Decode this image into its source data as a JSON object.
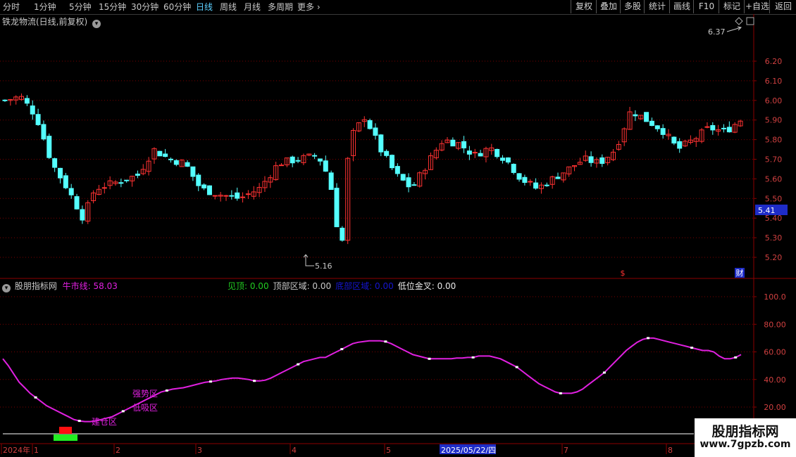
{
  "toolbar": {
    "timeframes": [
      "分时",
      "1分钟",
      "5分钟",
      "15分钟",
      "30分钟",
      "60分钟",
      "日线",
      "周线",
      "月线",
      "多周期",
      "更多"
    ],
    "active_timeframe": "日线",
    "right_buttons": [
      "复权",
      "叠加",
      "多股",
      "统计",
      "画线",
      "F10",
      "标记",
      "+自选",
      "返回"
    ]
  },
  "price_panel": {
    "stock_title": "铁龙物流(日线,前复权)",
    "y_ticks": [
      "6.20",
      "6.10",
      "6.00",
      "5.90",
      "5.80",
      "5.70",
      "5.60",
      "5.50",
      "5.40",
      "5.30",
      "5.20"
    ],
    "current_price_tag": "5.41",
    "high_annotation": "6.37",
    "low_annotation": "5.16",
    "marker_dollar": "$",
    "marker_cai": "财"
  },
  "indicator_panel": {
    "name": "股朋指标网",
    "bull_label": "牛市线:",
    "bull_value": "58.03",
    "items": [
      {
        "label": "见顶:",
        "value": "0.00",
        "color": "#22cc22"
      },
      {
        "label": "顶部区域:",
        "value": "0.00",
        "color": "#c8c8c8"
      },
      {
        "label": "底部区域:",
        "value": "0.00",
        "color": "#1515d0"
      },
      {
        "label": "低位金叉:",
        "value": "0.00",
        "color": "#e8e8e8"
      }
    ],
    "y_ticks": [
      "100.0",
      "80.00",
      "60.00",
      "40.00",
      "20.00"
    ],
    "zone_labels": [
      "强势区",
      "低吸区",
      "建仓区"
    ]
  },
  "time_axis": {
    "labels": [
      "2024年",
      "1",
      "2",
      "3",
      "4",
      "5",
      "2025/05/22/四",
      "7",
      "8"
    ]
  },
  "watermark": {
    "line1": "股朋指标网",
    "line2": "www.7gpzb.com"
  },
  "colors": {
    "up": "#ff3232",
    "down": "#54ffff",
    "bull_line": "#e020e0",
    "grid": "#7a0000",
    "axis": "#8b0000"
  },
  "chart_data": {
    "type": "candlestick",
    "price_range": [
      5.16,
      6.37
    ],
    "indicator_series": {
      "name": "牛市线",
      "values": [
        55,
        50,
        44,
        38,
        34,
        30,
        27,
        24,
        21,
        19,
        17,
        15,
        13,
        11,
        10,
        9.5,
        9.5,
        10,
        11,
        12,
        13,
        15,
        17,
        19,
        21,
        23,
        25,
        27,
        29,
        31,
        32,
        33,
        33.5,
        34,
        35,
        36,
        37,
        38,
        38.5,
        39,
        40,
        40.5,
        41,
        41,
        40.5,
        40,
        39,
        39,
        39.5,
        41,
        43,
        45,
        47,
        49,
        51,
        53,
        54,
        55,
        56,
        56,
        58,
        60,
        62,
        64,
        66,
        67,
        67.5,
        68,
        68,
        68,
        67.5,
        66,
        64,
        62,
        60,
        58,
        57,
        56,
        55,
        55,
        55,
        55,
        55,
        55.5,
        55.5,
        56,
        56,
        57,
        57,
        57,
        56,
        55,
        53,
        51,
        49,
        46,
        43,
        40,
        37,
        35,
        33,
        31,
        30,
        30,
        30,
        31,
        33,
        36,
        39,
        42,
        45,
        49,
        53,
        57,
        61,
        64,
        67,
        69,
        70,
        70,
        69,
        68,
        67,
        66,
        65,
        64,
        63,
        62,
        61,
        61,
        60,
        57,
        55,
        55,
        56,
        58
      ]
    }
  }
}
